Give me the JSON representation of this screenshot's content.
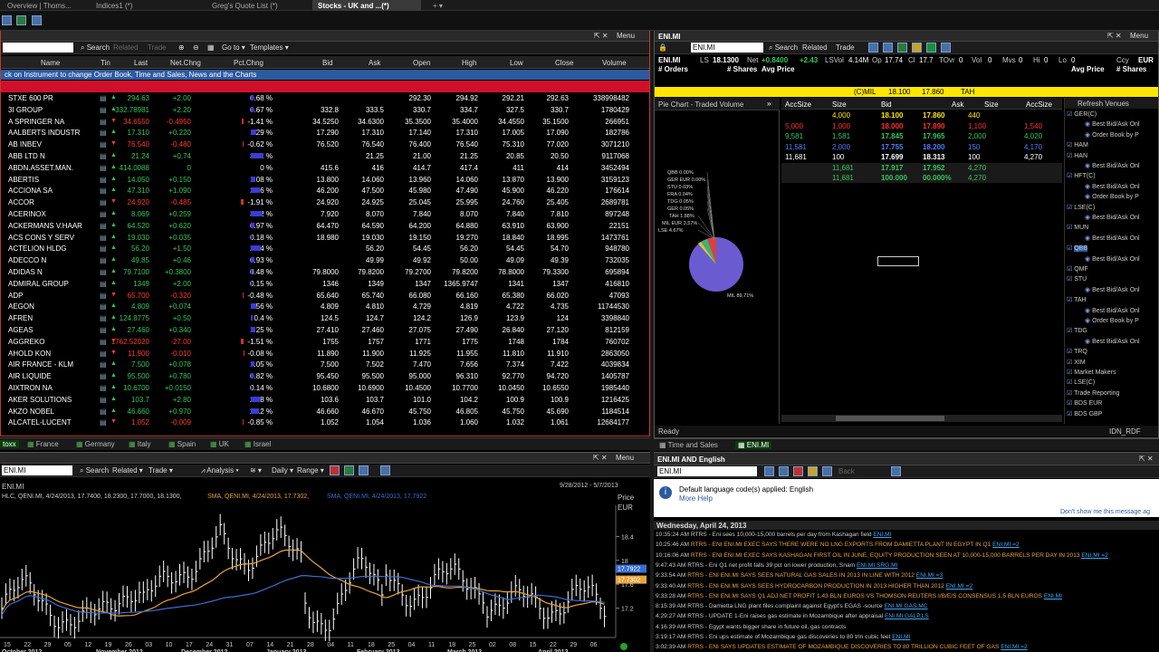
{
  "tabs": [
    {
      "label": "Overview | Thoms..."
    },
    {
      "label": "Indices1 (*)"
    },
    {
      "label": "Greg's Quote List (*)"
    },
    {
      "label": "Stocks - UK and ...(*)"
    }
  ],
  "quotes": {
    "search_label": "Search",
    "related": "Related",
    "trade": "Trade",
    "goto": "Go to",
    "templates": "Templates",
    "menu": "Menu",
    "headers": [
      "Name",
      "Tin",
      "Last",
      "Net.Chng",
      "Pct.Chng",
      "Bid",
      "Ask",
      "Open",
      "High",
      "Low",
      "Close",
      "Volume"
    ],
    "info": "ck on Instrument to change Order Book, Time and Sales, News and the Charts",
    "rows": [
      {
        "name": "STXE 600 PR",
        "last": "294.63",
        "net": "+2.00",
        "pct": "0.68 %",
        "bid": "",
        "ask": "",
        "open": "292.30",
        "high": "294.92",
        "low": "292.21",
        "close": "292.63",
        "vol": "338998482",
        "d": "up",
        "bw": 3
      },
      {
        "name": "3I GROUP",
        "last": "332.78981",
        "net": "+2.20",
        "pct": "0.67 %",
        "bid": "332.8",
        "ask": "333.5",
        "open": "330.7",
        "high": "334.7",
        "low": "327.5",
        "close": "330.7",
        "vol": "1780429",
        "d": "up",
        "bw": 3
      },
      {
        "name": "A SPRINGER NA",
        "last": "34.6550",
        "net": "-0.4950",
        "pct": "-1.41 %",
        "bid": "34.5250",
        "ask": "34.6300",
        "open": "35.3500",
        "high": "35.4000",
        "low": "34.4550",
        "close": "35.1500",
        "vol": "266951",
        "d": "dn",
        "bw": 5
      },
      {
        "name": "AALBERTS INDUSTR",
        "last": "17.310",
        "net": "+0.220",
        "pct": "1.29 %",
        "bid": "17.290",
        "ask": "17.310",
        "open": "17.140",
        "high": "17.310",
        "low": "17.005",
        "close": "17.090",
        "vol": "182786",
        "d": "up",
        "bw": 6
      },
      {
        "name": "AB INBEV",
        "last": "76.540",
        "net": "-0.480",
        "pct": "-0.62 %",
        "bid": "76.520",
        "ask": "76.540",
        "open": "76.400",
        "high": "76.540",
        "low": "75.310",
        "close": "77.020",
        "vol": "3071210",
        "d": "dn",
        "bw": 3
      },
      {
        "name": "ABB LTD N",
        "last": "21.24",
        "net": "+0.74",
        "pct": "3.61 %",
        "bid": "",
        "ask": "21.25",
        "open": "21.00",
        "high": "21.25",
        "low": "20.85",
        "close": "20.50",
        "vol": "9117068",
        "d": "up",
        "bw": 14
      },
      {
        "name": "ABDN.ASSET.MAN.",
        "last": "414.0088",
        "net": "0",
        "pct": "0 %",
        "bid": "415.6",
        "ask": "416",
        "open": "414.7",
        "high": "417.4",
        "low": "411",
        "close": "414",
        "vol": "3452494",
        "d": "up",
        "bw": 0
      },
      {
        "name": "ABERTIS",
        "last": "14.050",
        "net": "+0.150",
        "pct": "1.08 %",
        "bid": "13.800",
        "ask": "14.060",
        "open": "13.960",
        "high": "14.060",
        "low": "13.870",
        "close": "13.900",
        "vol": "3159123",
        "d": "up",
        "bw": 5
      },
      {
        "name": "ACCIONA SA",
        "last": "47.310",
        "net": "+1.090",
        "pct": "2.36 %",
        "bid": "46.200",
        "ask": "47.500",
        "open": "45.980",
        "high": "47.490",
        "low": "45.900",
        "close": "46.220",
        "vol": "176614",
        "d": "up",
        "bw": 10
      },
      {
        "name": "ACCOR",
        "last": "24.920",
        "net": "-0.485",
        "pct": "-1.91 %",
        "bid": "24.920",
        "ask": "24.925",
        "open": "25.045",
        "high": "25.995",
        "low": "24.760",
        "close": "25.405",
        "vol": "2689781",
        "d": "dn",
        "bw": 7
      },
      {
        "name": "ACERINOX",
        "last": "8.069",
        "net": "+0.259",
        "pct": "3.32 %",
        "bid": "7.920",
        "ask": "8.070",
        "open": "7.840",
        "high": "8.070",
        "low": "7.840",
        "close": "7.810",
        "vol": "897248",
        "d": "up",
        "bw": 13
      },
      {
        "name": "ACKERMANS V.HAAR",
        "last": "64.520",
        "net": "+0.620",
        "pct": "0.97 %",
        "bid": "64.470",
        "ask": "64.590",
        "open": "64.200",
        "high": "64.880",
        "low": "63.910",
        "close": "63.900",
        "vol": "22151",
        "d": "up",
        "bw": 4
      },
      {
        "name": "ACS CONS Y SERV",
        "last": "19.030",
        "net": "+0.035",
        "pct": "0.18 %",
        "bid": "18.980",
        "ask": "19.030",
        "open": "19.150",
        "high": "19.270",
        "low": "18.840",
        "close": "18.995",
        "vol": "1473761",
        "d": "up",
        "bw": 1
      },
      {
        "name": "ACTELION HLDG",
        "last": "56.20",
        "net": "+1.50",
        "pct": "2.74 %",
        "bid": "",
        "ask": "56.20",
        "open": "54.45",
        "high": "56.20",
        "low": "54.45",
        "close": "54.70",
        "vol": "948780",
        "d": "up",
        "bw": 11
      },
      {
        "name": "ADECCO N",
        "last": "49.85",
        "net": "+0.46",
        "pct": "0.93 %",
        "bid": "",
        "ask": "49.99",
        "open": "49.92",
        "high": "50.00",
        "low": "49.09",
        "close": "49.39",
        "vol": "732035",
        "d": "up",
        "bw": 4
      },
      {
        "name": "ADIDAS N",
        "last": "79.7100",
        "net": "+0.3800",
        "pct": "0.48 %",
        "bid": "79.8000",
        "ask": "79.8200",
        "open": "79.2700",
        "high": "79.8200",
        "low": "78.8000",
        "close": "79.3300",
        "vol": "695894",
        "d": "up",
        "bw": 2
      },
      {
        "name": "ADMIRAL GROUP",
        "last": "1349",
        "net": "+2.00",
        "pct": "0.15 %",
        "bid": "1346",
        "ask": "1349",
        "open": "1347",
        "high": "1365.9747",
        "low": "1341",
        "close": "1347",
        "vol": "416810",
        "d": "up",
        "bw": 1
      },
      {
        "name": "ADP",
        "last": "65.700",
        "net": "-0.320",
        "pct": "-0.48 %",
        "bid": "65.640",
        "ask": "65.740",
        "open": "66.080",
        "high": "66.160",
        "low": "65.380",
        "close": "66.020",
        "vol": "47093",
        "d": "dn",
        "bw": 2
      },
      {
        "name": "AEGON",
        "last": "4.809",
        "net": "+0.074",
        "pct": "1.56 %",
        "bid": "4.809",
        "ask": "4.810",
        "open": "4.729",
        "high": "4.819",
        "low": "4.722",
        "close": "4.735",
        "vol": "11744530",
        "d": "up",
        "bw": 6
      },
      {
        "name": "AFREN",
        "last": "124.8775",
        "net": "+0.50",
        "pct": "0.4 %",
        "bid": "124.5",
        "ask": "124.7",
        "open": "124.2",
        "high": "126.9",
        "low": "123.9",
        "close": "124",
        "vol": "3398840",
        "d": "up",
        "bw": 2
      },
      {
        "name": "AGEAS",
        "last": "27.460",
        "net": "+0.340",
        "pct": "1.25 %",
        "bid": "27.410",
        "ask": "27.460",
        "open": "27.075",
        "high": "27.490",
        "low": "26.840",
        "close": "27.120",
        "vol": "812159",
        "d": "up",
        "bw": 5
      },
      {
        "name": "AGGREKO",
        "last": "1762.52020",
        "net": "-27.00",
        "pct": "-1.51 %",
        "bid": "1755",
        "ask": "1757",
        "open": "1771",
        "high": "1775",
        "low": "1748",
        "close": "1784",
        "vol": "760702",
        "d": "dn",
        "bw": 6
      },
      {
        "name": "AHOLD KON",
        "last": "11.900",
        "net": "-0.010",
        "pct": "-0.08 %",
        "bid": "11.890",
        "ask": "11.900",
        "open": "11.925",
        "high": "11.955",
        "low": "11.810",
        "close": "11.910",
        "vol": "2863050",
        "d": "dn",
        "bw": 1
      },
      {
        "name": "AIR FRANCE - KLM",
        "last": "7.500",
        "net": "+0.078",
        "pct": "1.05 %",
        "bid": "7.500",
        "ask": "7.502",
        "open": "7.470",
        "high": "7.656",
        "low": "7.374",
        "close": "7.422",
        "vol": "4039834",
        "d": "up",
        "bw": 4
      },
      {
        "name": "AIR LIQUIDE",
        "last": "95.500",
        "net": "+0.780",
        "pct": "0.82 %",
        "bid": "95.450",
        "ask": "95.500",
        "open": "95.000",
        "high": "96.310",
        "low": "92.770",
        "close": "94.720",
        "vol": "1405787",
        "d": "up",
        "bw": 3
      },
      {
        "name": "AIXTRON NA",
        "last": "10.6700",
        "net": "+0.0150",
        "pct": "0.14 %",
        "bid": "10.6800",
        "ask": "10.6900",
        "open": "10.4500",
        "high": "10.7700",
        "low": "10.0450",
        "close": "10.6550",
        "vol": "1985440",
        "d": "up",
        "bw": 1
      },
      {
        "name": "AKER SOLUTIONS",
        "last": "103.7",
        "net": "+2.80",
        "pct": "2.78 %",
        "bid": "103.6",
        "ask": "103.7",
        "open": "101.0",
        "high": "104.2",
        "low": "100.9",
        "close": "100.9",
        "vol": "1216425",
        "d": "up",
        "bw": 11
      },
      {
        "name": "AKZO NOBEL",
        "last": "46.660",
        "net": "+0.970",
        "pct": "2.12 %",
        "bid": "46.660",
        "ask": "46.670",
        "open": "45.750",
        "high": "46.805",
        "low": "45.750",
        "close": "45.690",
        "vol": "1184514",
        "d": "up",
        "bw": 9
      },
      {
        "name": "ALCATEL-LUCENT",
        "last": "1.052",
        "net": "-0.009",
        "pct": "-0.85 %",
        "bid": "1.052",
        "ask": "1.054",
        "open": "1.036",
        "high": "1.060",
        "low": "1.032",
        "close": "1.061",
        "vol": "12684177",
        "d": "dn",
        "bw": 3
      }
    ]
  },
  "region_tabs": [
    "toxx",
    "France",
    "Germany",
    "Italy",
    "Spain",
    "UK",
    "Israel"
  ],
  "orderbook": {
    "title": "ENI.MI",
    "ric": "ENI.MI",
    "search": "Search",
    "related": "Related",
    "trade": "Trade",
    "menu": "Menu",
    "line1": {
      "ric": "ENI.MI",
      "ls_label": "LS",
      "ls": "18.1300",
      "net_label": "Net",
      "net": "+0.8400",
      "chg": "+2.43",
      "lsvol_label": "LSVol",
      "lsvol": "4.14M",
      "op_label": "Op",
      "op": "17.74",
      "cl_label": "Cl",
      "cl": "17.7",
      "tovr_label": "TOvr",
      "tovr": "0",
      "vol_label": "Vol",
      "vol": "0",
      "mvs_label": "Mvs",
      "mvs": "0",
      "hi_label": "Hi",
      "hi": "0",
      "lo_label": "Lo",
      "lo": "0",
      "ccy_label": "Ccy",
      "ccy": "EUR"
    },
    "line2": [
      "# Orders",
      "Avg Price",
      "# Shares",
      "Avg Price",
      "Avg Price",
      "# Shares",
      "# Orders"
    ],
    "yellow_bar": {
      "ex": "(C)MIL",
      "bid": "18.100",
      "ask": "17.860",
      "tah": "TAH"
    },
    "pie_title": "Pie Chart - Traded Volume",
    "pie_labels": [
      "QBB 0.00%",
      "GER EUR 0.00%",
      "STU 0.03%",
      "FRA 0.04%",
      "TDG 0.05%",
      "GER 0.05%",
      "TAH 1.88%",
      "MIL EUR 3.57%",
      "LSE 4.67%",
      "MIL 89.71%"
    ],
    "depth_hdr": [
      "AccSize",
      "Size",
      "Bid",
      "Ask",
      "Size",
      "AccSize"
    ],
    "depth": [
      {
        "accb": "",
        "sizeb": "4,000",
        "bid": "18.100",
        "ask": "17.860",
        "sizea": "440",
        "acca": "",
        "c": "y"
      },
      {
        "accb": "5,000",
        "sizeb": "1,000",
        "bid": "18.000",
        "ask": "17.890",
        "sizea": "1,100",
        "acca": "1,540",
        "c": "r"
      },
      {
        "accb": "9,581",
        "sizeb": "1,581",
        "bid": "17.845",
        "ask": "17.965",
        "sizea": "2,000",
        "acca": "4,020",
        "c": "g"
      },
      {
        "accb": "11,581",
        "sizeb": "2,000",
        "bid": "17.755",
        "ask": "18.200",
        "sizea": "150",
        "acca": "4,170",
        "c": "b"
      },
      {
        "accb": "11,681",
        "sizeb": "100",
        "bid": "17.699",
        "ask": "18.313",
        "sizea": "100",
        "acca": "4,270",
        "c": "w"
      },
      {
        "accb": "",
        "sizeb": "11,681",
        "bid": "17.917",
        "ask": "17.952",
        "sizea": "4,270",
        "acca": "",
        "c": "c"
      },
      {
        "accb": "",
        "sizeb": "11,681",
        "bid": "100.000",
        "ask": "00.000%",
        "sizea": "4,270",
        "acca": "",
        "c": "c"
      }
    ],
    "venues_title": "Refresh Venues",
    "venues": [
      "GER(C)",
      "Best Bid/Ask Onl",
      "Order Book by P",
      "HAM",
      "HAN",
      "Best Bid/Ask Onl",
      "HFT(C)",
      "Best Bid/Ask Onl",
      "Order Book by P",
      "LSE(C)",
      "Best Bid/Ask Onl",
      "MUN",
      "Best Bid/Ask Onl",
      "QBB",
      "Best Bid/Ask Onl",
      "QMF",
      "STU",
      "Best Bid/Ask Onl",
      "TAH",
      "Best Bid/Ask Onl",
      "Order Book by P",
      "TDG",
      "Best Bid/Ask Onl",
      "TRQ",
      "XIM",
      "Market Makers",
      "LSE(C)",
      "Trade Reporting",
      "BDS EUR",
      "BDS GBP"
    ],
    "status": "Ready",
    "status_right": "IDN_RDF",
    "bottom_tabs": [
      "Time and Sales",
      "ENI.MI"
    ]
  },
  "chart": {
    "ric": "ENI.MI",
    "search": "Search",
    "related": "Related",
    "trade": "Trade",
    "analysis": "Analysis",
    "daily": "Daily",
    "range": "Range",
    "menu": "Menu",
    "title": "ENI.MI",
    "legend1": "HLC, QENI.MI, 4/24/2013, 17.7400, 18.2300, 17.7000, 18.1300,",
    "legend2": "SMA, QENI.MI, 4/24/2013, 17.7302,",
    "legend3": "SMA, QENI.MI, 4/24/2013, 17.7922",
    "date_range": "9/28/2012 - 5/7/2013",
    "price_label": "Price",
    "ccy": "EUR",
    "y_ticks": [
      "18.4",
      "18",
      "17.6",
      "17.2"
    ],
    "price_tags": [
      "17.7922",
      "17.7302"
    ],
    "x_days": [
      "15",
      "22",
      "29",
      "05",
      "12",
      "19",
      "26",
      "03",
      "10",
      "17",
      "24",
      "31",
      "07",
      "14",
      "21",
      "28",
      "04",
      "11",
      "18",
      "25",
      "04",
      "11",
      "18",
      "25",
      "02",
      "08",
      "15",
      "22",
      "29",
      "06"
    ],
    "months": [
      "October 2012",
      "November 2012",
      "December 2012",
      "January 2013",
      "February 2013",
      "March 2013",
      "April 2013"
    ]
  },
  "news": {
    "title": "ENI.MI AND English",
    "query": "ENI.MI",
    "back": "Back",
    "notice": "Default language code(s) applied: English",
    "more_help": "More Help",
    "dont_show": "Don't show me this message ag",
    "date": "Wednesday, April 24, 2013",
    "items": [
      {
        "t": "10:35:24 AM",
        "h": "RTRS - Eni sees 10,000-15,000 barrels per day from Kashagan field",
        "l": "ENI.MI",
        "c": "#cccccc"
      },
      {
        "t": "10:25:46 AM",
        "h": "RTRS - ENI ENI.MI EXEC SAYS THERE WERE NO LNG EXPORTS FROM DAMIETTA PLANT IN EGYPT IN Q1",
        "l": "ENI.MI =2",
        "c": "#e8a33d"
      },
      {
        "t": "10:16:06 AM",
        "h": "RTRS - ENI ENI.MI EXEC SAYS KASHAGAN FIRST OIL IN JUNE, EQUITY PRODUCTION SEEN AT 10,000-15,000 BARRELS PER DAY IN 2013",
        "l": "ENI.MI =2",
        "c": "#e8a33d"
      },
      {
        "t": "9:47:43 AM",
        "h": "RTRS - Eni Q1 net profit falls 39 pct on lower production, Snam",
        "l": "ENI.MI SRG.MI",
        "c": "#cccccc"
      },
      {
        "t": "9:33:54 AM",
        "h": "RTRS - ENI ENI.MI SAYS SEES NATURAL GAS SALES IN 2013 IN LINE WITH 2012",
        "l": "ENI.MI =3",
        "c": "#e8a33d"
      },
      {
        "t": "9:33:40 AM",
        "h": "RTRS - ENI ENI.MI SAYS SEES HYDROCARBON PRODUCTION IN 2013 HIGHER THAN 2012",
        "l": "ENI.MI =2",
        "c": "#e8a33d"
      },
      {
        "t": "9:33:28 AM",
        "h": "RTRS - ENI ENI.MI SAYS Q1 ADJ NET PROFIT 1.43 BLN EUROS VS THOMSON REUTERS I/B/E/S CONSENSUS 1.5 BLN EUROS",
        "l": "ENI.MI",
        "c": "#e8a33d"
      },
      {
        "t": "8:15:39 AM",
        "h": "RTRS - Damietta LNG plant files complaint against Egypt's EGAS -source",
        "l": "ENI.MI GAS.MC",
        "c": "#cccccc"
      },
      {
        "t": "4:29:27 AM",
        "h": "RTRS - UPDATE 1-Eni raises gas estimate in Mozambique after appraisal",
        "l": "ENI.MI GALP.LS",
        "c": "#cccccc"
      },
      {
        "t": "4:16:39 AM",
        "h": "RTRS - Egypt wants bigger share in future oil, gas contracts",
        "l": "",
        "c": "#cccccc"
      },
      {
        "t": "3:19:17 AM",
        "h": "RTRS - Eni ups estimate of Mozambique gas discoveries to 80 trln cubic feet",
        "l": "ENI.MI",
        "c": "#cccccc"
      },
      {
        "t": "3:02:39 AM",
        "h": "RTRS - ENI SAYS UPDATES ESTIMATE OF MOZAMBIQUE DISCOVERIES TO 80 TRILLION CUBIC FEET OF GAS",
        "l": "ENI.MI =2",
        "c": "#e8a33d"
      }
    ]
  },
  "colors": {
    "up": "#34c759",
    "down": "#ff3b30",
    "header_red": "#d0102a",
    "info_blue": "#2c5aa0",
    "yellow": "#ffd700",
    "pie": "#6b5bd0"
  }
}
